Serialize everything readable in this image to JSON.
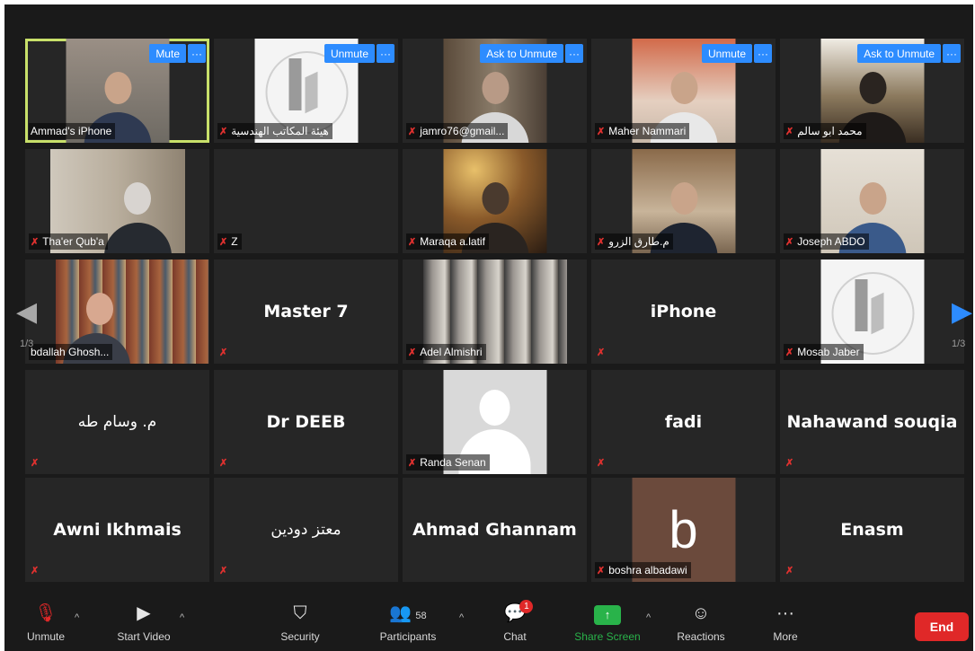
{
  "tiles": [
    {
      "name": "Ammad's iPhone",
      "action": "Mute",
      "more": "···"
    },
    {
      "name": "هيئة المكاتب الهندسية",
      "action": "Unmute",
      "more": "···"
    },
    {
      "name": "jamro76@gmail...",
      "action": "Ask to Unmute",
      "more": "···"
    },
    {
      "name": "Maher Nammari",
      "action": "Unmute",
      "more": "···"
    },
    {
      "name": "محمد ابو سالم",
      "action": "Ask to Unmute",
      "more": "···"
    },
    {
      "name": "Tha'er Qub'a"
    },
    {
      "name": "Z"
    },
    {
      "name": "Maraqa a.latif"
    },
    {
      "name": "م.طارق الزرو"
    },
    {
      "name": "Joseph ABDO"
    },
    {
      "name": "bdallah Ghosh..."
    },
    {
      "name": "Master 7"
    },
    {
      "name": "Adel Almishri"
    },
    {
      "name": "iPhone"
    },
    {
      "name": "Mosab Jaber"
    },
    {
      "name": "م. وسام طه"
    },
    {
      "name": "Dr DEEB"
    },
    {
      "name": "Randa Senan"
    },
    {
      "name": "fadi"
    },
    {
      "name": "Nahawand souqia"
    },
    {
      "name": "Awni Ikhmais"
    },
    {
      "name": "معتز دودين"
    },
    {
      "name": "Ahmad Ghannam"
    },
    {
      "name": "boshra albadawi",
      "avatar_letter": "b"
    },
    {
      "name": "Enasm"
    }
  ],
  "pagination": {
    "left": "1/3",
    "right": "1/3"
  },
  "toolbar": {
    "unmute": "Unmute",
    "start_video": "Start Video",
    "security": "Security",
    "participants": "Participants",
    "participants_count": "58",
    "chat": "Chat",
    "chat_badge": "1",
    "share_screen": "Share Screen",
    "reactions": "Reactions",
    "more": "More",
    "more_dots": "···",
    "end": "End"
  },
  "colors": {
    "accent": "#2d8cff",
    "end": "#e02828",
    "share": "#29b34a",
    "active_border": "#c8e06a",
    "share_label": "#29b34a"
  }
}
